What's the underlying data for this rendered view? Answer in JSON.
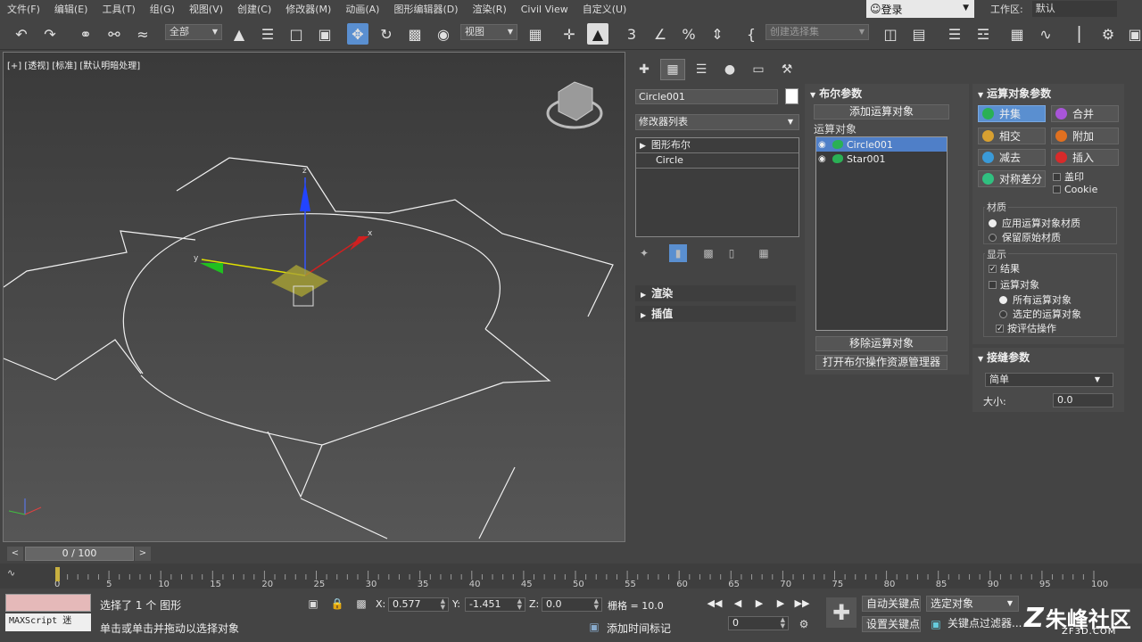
{
  "menu": [
    "文件(F)",
    "编辑(E)",
    "工具(T)",
    "组(G)",
    "视图(V)",
    "创建(C)",
    "修改器(M)",
    "动画(A)",
    "图形编辑器(D)",
    "渲染(R)",
    "Civil View",
    "自定义(U)"
  ],
  "login": "登录",
  "workspace": {
    "label": "工作区:",
    "value": "默认"
  },
  "toolbar": {
    "filter": "全部",
    "refcoord": "视图",
    "selset_placeholder": "创建选择集"
  },
  "viewport": {
    "label": "[+] [透视] [标准] [默认明暗处理]",
    "gizmo_labels": {
      "x": "x",
      "y": "y",
      "z": "z"
    }
  },
  "command_panel": {
    "object_name": "Circle001",
    "modifier_list": "修改器列表",
    "stack": [
      {
        "label": "图形布尔",
        "expanded": false
      },
      {
        "label": "Circle"
      }
    ],
    "rollouts": [
      "渲染",
      "插值"
    ]
  },
  "boolean_params": {
    "title": "布尔参数",
    "add_operand": "添加运算对象",
    "operands_label": "运算对象",
    "operands": [
      {
        "name": "Circle001",
        "selected": true
      },
      {
        "name": "Star001",
        "selected": false
      }
    ],
    "remove_operand": "移除运算对象",
    "open_explorer": "打开布尔操作资源管理器"
  },
  "operand_params": {
    "title": "运算对象参数",
    "ops": [
      {
        "label": "并集",
        "color": "#2ab055",
        "active": true
      },
      {
        "label": "合并",
        "color": "#a855d8",
        "active": false
      },
      {
        "label": "相交",
        "color": "#d8a030",
        "active": false
      },
      {
        "label": "附加",
        "color": "#e07020",
        "active": false
      },
      {
        "label": "减去",
        "color": "#3a9ad8",
        "active": false
      },
      {
        "label": "插入",
        "color": "#d82a2a",
        "active": false
      },
      {
        "label": "对称差分",
        "color": "#30c080",
        "active": false
      }
    ],
    "imprint": "盖印",
    "cookie": "Cookie",
    "material_group": "材质",
    "mat_apply": "应用运算对象材质",
    "mat_keep": "保留原始材质",
    "display_group": "显示",
    "disp_result": "结果",
    "disp_operands": "运算对象",
    "disp_all": "所有运算对象",
    "disp_selected": "选定的运算对象",
    "disp_eval": "按评估操作"
  },
  "stitch_params": {
    "title": "接缝参数",
    "mode": "简单",
    "size_label": "大小:",
    "size_value": "0.0"
  },
  "timeline": {
    "frame": "0 / 100",
    "ticks": [
      "0",
      "5",
      "10",
      "15",
      "20",
      "25",
      "30",
      "35",
      "40",
      "45",
      "50",
      "55",
      "60",
      "65",
      "70",
      "75",
      "80",
      "85",
      "90",
      "95",
      "100"
    ]
  },
  "status": {
    "maxscript": "MAXScript 迷",
    "selection": "选择了 1 个 图形",
    "prompt": "单击或单击并拖动以选择对象",
    "x_label": "X:",
    "x_value": "0.577",
    "y_label": "Y:",
    "y_value": "-1.451",
    "z_label": "Z:",
    "z_value": "0.0",
    "grid": "栅格 = 10.0",
    "add_time_tag": "添加时间标记",
    "auto_key": "自动关键点",
    "set_key": "设置关键点",
    "selected_obj": "选定对象",
    "key_filter": "关键点过滤器...",
    "frame_field": "0"
  },
  "logo": {
    "text": "朱峰社区",
    "url": "ZF3D.COM"
  }
}
